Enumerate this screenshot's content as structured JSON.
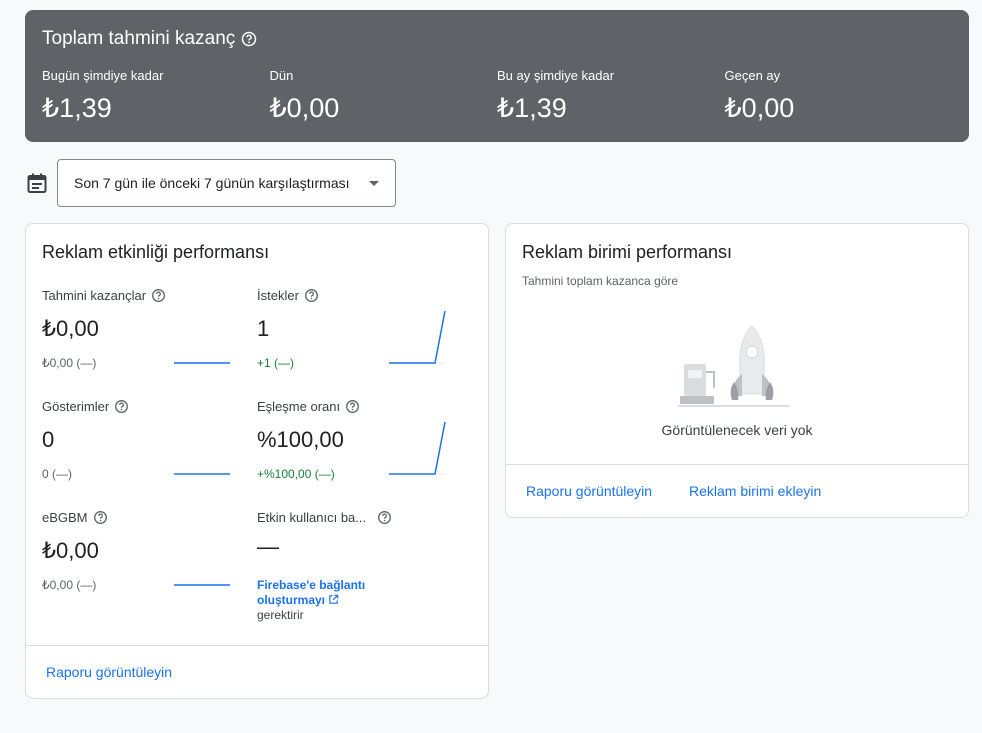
{
  "earnings": {
    "title": "Toplam tahmini kazanç",
    "items": [
      {
        "label": "Bugün şimdiye kadar",
        "value": "₺1,39"
      },
      {
        "label": "Dün",
        "value": "₺0,00"
      },
      {
        "label": "Bu ay şimdiye kadar",
        "value": "₺1,39"
      },
      {
        "label": "Geçen ay",
        "value": "₺0,00"
      }
    ]
  },
  "date_range": {
    "selected": "Son 7 gün ile önceki 7 günün karşılaştırması"
  },
  "ad_activity": {
    "title": "Reklam etkinliği performansı",
    "metrics": [
      {
        "label": "Tahmini kazançlar",
        "value": "₺0,00",
        "delta": "₺0,00 (—)"
      },
      {
        "label": "İstekler",
        "value": "1",
        "delta": "+1 (—)"
      },
      {
        "label": "Gösterimler",
        "value": "0",
        "delta": "0 (—)"
      },
      {
        "label": "Eşleşme oranı",
        "value": "%100,00",
        "delta": "+%100,00 (—)"
      },
      {
        "label": "eBGBM",
        "value": "₺0,00",
        "delta": "₺0,00 (—)"
      },
      {
        "label": "Etkin kullanıcı ba...",
        "value": "—",
        "link_line1": "Firebase'e bağlantı",
        "link_line2": "oluşturmayı",
        "note": "gerektirir"
      }
    ],
    "report_link": "Raporu görüntüleyin"
  },
  "ad_unit": {
    "title": "Reklam birimi performansı",
    "subtitle": "Tahmini toplam kazanca göre",
    "empty": "Görüntülenecek veri yok",
    "report_link": "Raporu görüntüleyin",
    "add_link": "Reklam birimi ekleyin"
  },
  "colors": {
    "accent": "#1a73e8",
    "positive": "#188038",
    "banner": "#5f6368"
  }
}
